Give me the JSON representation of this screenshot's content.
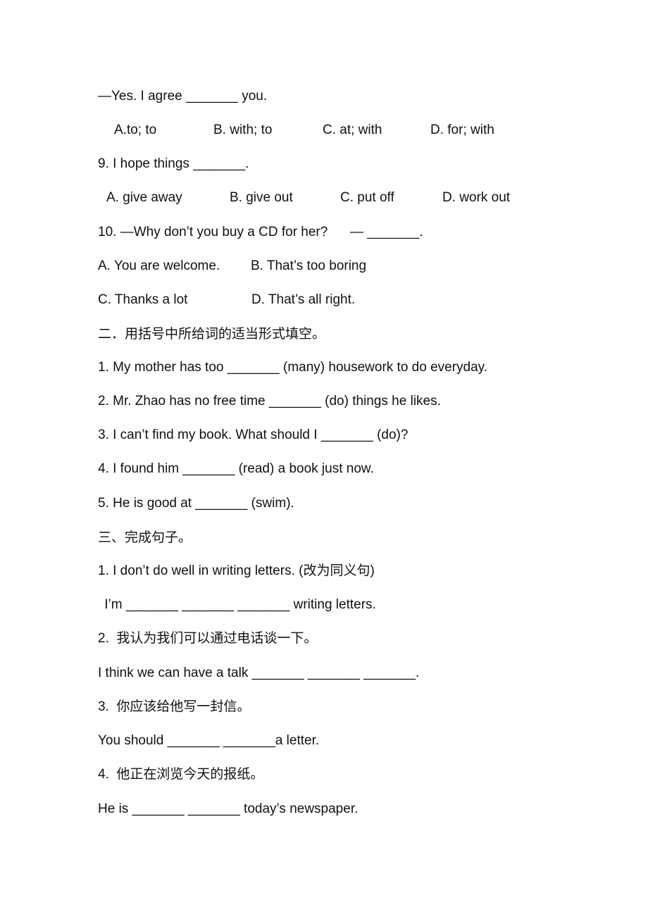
{
  "part1_tail": {
    "q8_reply": "—Yes. I agree _______ you.",
    "q8_options": [
      "A.to; to",
      "B. with; to",
      "C. at; with",
      "D. for; with"
    ],
    "q9": "9. I hope things _______.",
    "q9_options": [
      "A. give away",
      "B. give out",
      "C. put off",
      "D. work out"
    ],
    "q10": "10. —Why don’t you buy a CD for her?      — _______.",
    "q10_options_row1": [
      "A. You are welcome.",
      "B. That’s too boring"
    ],
    "q10_options_row2": [
      "C. Thanks a lot",
      "D. That’s all right."
    ]
  },
  "part2": {
    "heading": "二．用括号中所给词的适当形式填空。",
    "items": [
      "1. My mother has too _______ (many) housework to do everyday.",
      "2. Mr. Zhao has no free time _______ (do) things he likes.",
      "3. I can’t find my book. What should I _______ (do)?",
      "4. I found him _______ (read) a book just now.",
      "5. He is good at _______ (swim)."
    ]
  },
  "part3": {
    "heading": "三、完成句子。",
    "items": [
      {
        "prompt": "1. I don’t do well in writing letters. (改为同义句)",
        "answer": " I’m _______ _______ _______ writing letters."
      },
      {
        "prompt": "2.  我认为我们可以通过电话谈一下。",
        "answer": "I think we can have a talk _______ _______ _______."
      },
      {
        "prompt": "3.  你应该给他写一封信。",
        "answer": "You should _______ _______a letter."
      },
      {
        "prompt": "4.  他正在浏览今天的报纸。",
        "answer": "He is _______ _______ today’s newspaper."
      }
    ]
  }
}
